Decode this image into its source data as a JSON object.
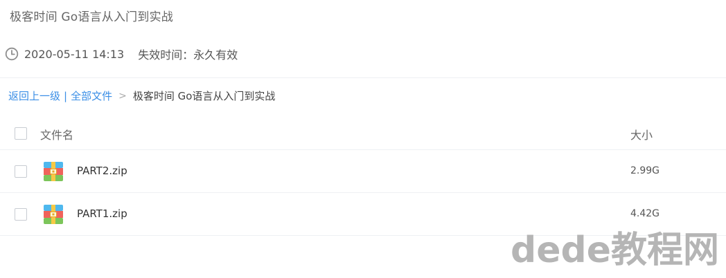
{
  "share": {
    "title": "极客时间 Go语言从入门到实战",
    "date": "2020-05-11 14:13",
    "expiry": "失效时间：永久有效"
  },
  "breadcrumb": {
    "back": "返回上一级",
    "separator": "|",
    "all_files": "全部文件",
    "arrow": ">",
    "current": "极客时间 Go语言从入门到实战"
  },
  "table": {
    "header_name": "文件名",
    "header_size": "大小",
    "files": [
      {
        "name": "PART2.zip",
        "size": "2.99G",
        "icon": "zip-archive-icon"
      },
      {
        "name": "PART1.zip",
        "size": "4.42G",
        "icon": "zip-archive-icon"
      }
    ]
  },
  "watermark": "dede教程网",
  "colors": {
    "link": "#3a8ee6",
    "divider": "#eef0f3",
    "watermark": "#b5b5b5"
  }
}
